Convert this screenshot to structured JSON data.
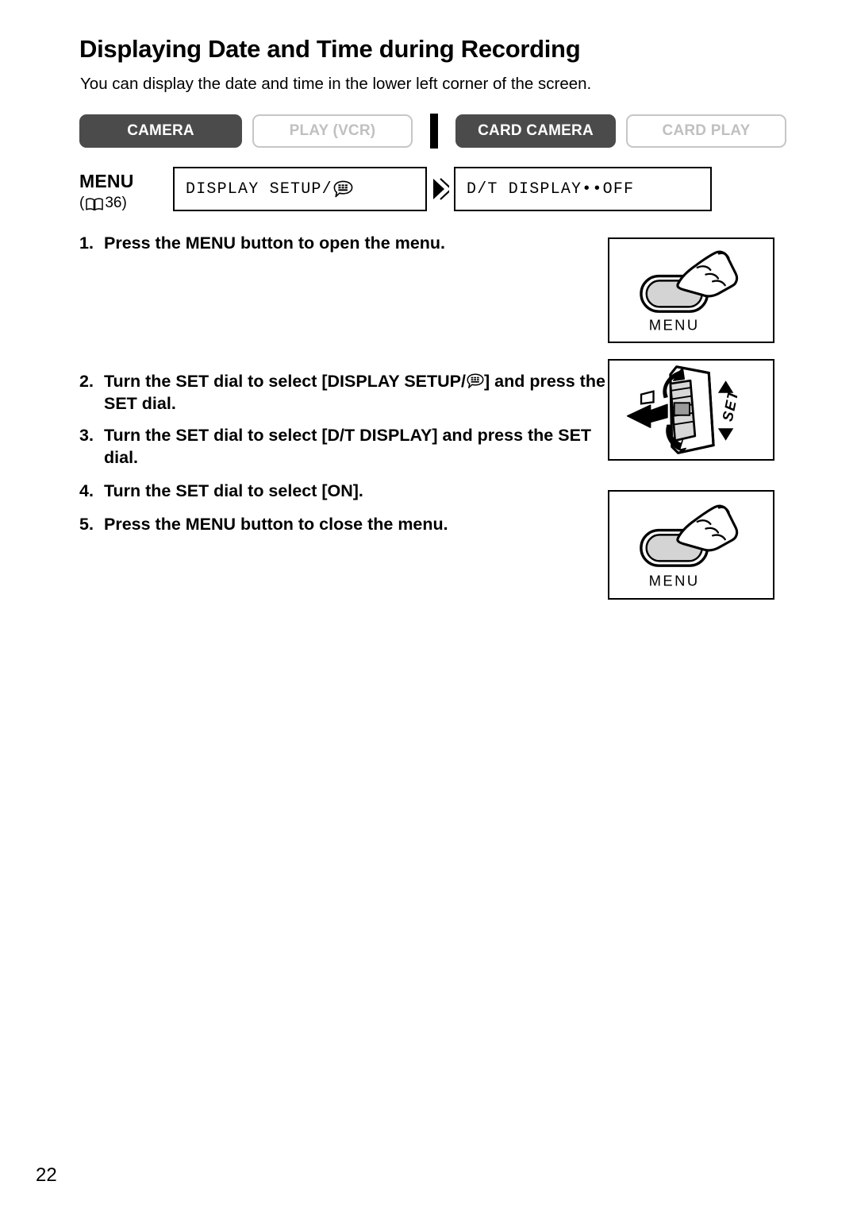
{
  "document": {
    "title": "Displaying Date and Time during Recording",
    "intro": "You can display the date and time in the lower left corner of the screen.",
    "page_number": "22"
  },
  "modes": {
    "items": [
      {
        "label": "CAMERA",
        "state": "active"
      },
      {
        "label": "PLAY (VCR)",
        "state": "inactive"
      },
      {
        "label": "CARD CAMERA",
        "state": "active"
      },
      {
        "label": "CARD PLAY",
        "state": "inactive"
      }
    ]
  },
  "menu_path": {
    "label": "MENU",
    "page_reference": "36)",
    "page_reference_open": "(",
    "boxes": [
      {
        "text": "DISPLAY SETUP/",
        "has_icon": true
      },
      {
        "text": "D/T DISPLAY••OFF",
        "has_icon": false
      }
    ]
  },
  "steps": [
    {
      "num": "1.",
      "text": "Press the MENU button to open the menu."
    },
    {
      "num": "2.",
      "text_before": "Turn the SET dial to select [DISPLAY SETUP/",
      "text_after": "] and press the SET dial."
    },
    {
      "num": "3.",
      "text": "Turn the SET dial to select [D/T DISPLAY] and press the SET dial."
    },
    {
      "num": "4.",
      "text": "Turn the SET dial to select [ON]."
    },
    {
      "num": "5.",
      "text": "Press the MENU button to close the menu."
    }
  ],
  "illustrations": [
    {
      "name": "menu-button-press",
      "caption": "MENU"
    },
    {
      "name": "set-dial",
      "caption": "SET"
    },
    {
      "name": "menu-button-press",
      "caption": "MENU"
    }
  ],
  "colors": {
    "active_button_bg": "#4b4b4b",
    "inactive_button_border": "#c6c6c6",
    "inactive_button_text": "#c0c0c0",
    "title_rule": "#b0b0b0",
    "button_face": "#d4d4d4"
  }
}
